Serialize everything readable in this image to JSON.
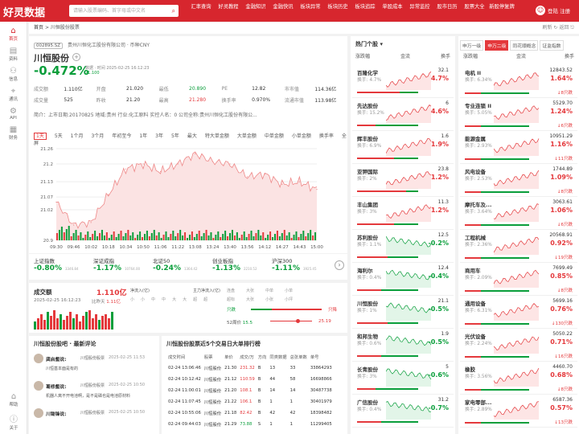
{
  "header": {
    "logo": "好灵数据",
    "search_placeholder": "请输入股票编码、首字母或中文名",
    "nav": [
      "汇率查询",
      "好灵教程",
      "金融知识",
      "金融快讯",
      "板块异常",
      "板块历史",
      "板块追踪",
      "单股成本",
      "异常监控",
      "股市日历",
      "股票大全",
      "新股停复牌"
    ],
    "user": "登陆 注册"
  },
  "sidebar": [
    {
      "glyph": "⌂",
      "label": "首页"
    },
    {
      "glyph": "▤",
      "label": "资料"
    },
    {
      "glyph": "⚇",
      "label": "信息"
    },
    {
      "glyph": "⌖",
      "label": "通讯"
    },
    {
      "glyph": "⚙",
      "label": "API"
    },
    {
      "glyph": "▦",
      "label": "财务"
    }
  ],
  "sidebar_bottom": [
    {
      "glyph": "⌂",
      "label": "帮助"
    },
    {
      "glyph": "ⓘ",
      "label": "关于"
    }
  ],
  "breadcrumb": {
    "home": "首页",
    "sep": ">",
    "current": "川恒股份股票",
    "refresh": "刷新",
    "back": "返回"
  },
  "stock": {
    "code": "002895.SZ",
    "company": "贵州川恒化工股份有限公司 · 币种CNY",
    "name": "川恒股份",
    "time_label": "数据 · 时间",
    "time": "2025-02-25 16:12:23",
    "pct": "-0.472%",
    "price": "21.100",
    "stats": [
      [
        "成交额",
        "1.110亿",
        "开盘",
        "21.020",
        "最低",
        "20.890",
        "PE",
        "12.82",
        "市市值",
        "114.36亿"
      ],
      [
        "成交量",
        "525",
        "昨收",
        "21.20",
        "最高",
        "21.280",
        "换手率",
        "0.970%",
        "流通市值",
        "113.98亿"
      ]
    ],
    "intro": "简介：上市日期:20170825 地域:贵州 行业:化工原料 实控人名：0 公司全称:贵州川恒化工股份有限公..."
  },
  "period_tabs": [
    "1天",
    "5天",
    "1个月",
    "3个月",
    "年初至今",
    "1年",
    "3年",
    "5年",
    "最大",
    "特大单金额",
    "大单金额",
    "中单金额",
    "小单金额",
    "换手率",
    "全屏"
  ],
  "chart_data": {
    "type": "area",
    "title": "",
    "xlabel": "",
    "ylabel": "",
    "x": [
      "09:30",
      "09:46",
      "10:02",
      "10:18",
      "10:34",
      "10:50",
      "11:06",
      "11:22",
      "13:08",
      "13:24",
      "13:40",
      "13:56",
      "14:12",
      "14:27",
      "14:43",
      "15:00"
    ],
    "values": [
      21.05,
      20.96,
      20.97,
      21.08,
      21.18,
      21.2,
      21.17,
      21.2,
      21.24,
      21.21,
      21.2,
      21.15,
      21.16,
      21.12,
      21.13,
      21.1
    ],
    "y_ticks": [
      "21.26",
      "21.2",
      "21.13",
      "21.07",
      "21.02",
      "20.9"
    ],
    "ylim": [
      20.9,
      21.26
    ],
    "grid": true
  },
  "indices": [
    {
      "name": "上证指数",
      "pct": "-0.80%",
      "val": "3346.84",
      "c": "green"
    },
    {
      "name": "深证成指",
      "pct": "-1.17%",
      "val": "10764.00",
      "c": "green"
    },
    {
      "name": "北证50",
      "pct": "-0.24%",
      "val": "1364.42",
      "c": "green"
    },
    {
      "name": "创业板指",
      "pct": "-1.13%",
      "val": "2210.52",
      "c": "green"
    },
    {
      "name": "沪深300",
      "pct": "-1.11%",
      "val": "3925.45",
      "c": "green"
    }
  ],
  "turnover": {
    "title": "成交额",
    "value": "1.110亿",
    "time": "2025-02-25 16:12:23",
    "prev_label": "比昨天",
    "prev": "1.11亿",
    "bars": [
      4,
      6,
      8,
      5,
      9,
      7,
      10,
      6,
      8,
      5,
      7,
      9,
      6,
      8,
      4,
      7,
      9,
      10,
      6,
      8,
      5,
      7,
      8,
      6,
      9
    ],
    "net_in": "净流入(亿)",
    "net_labels": [
      "小",
      "小",
      "中",
      "中",
      "大",
      "大",
      "超",
      "超"
    ],
    "main_net": "主力净流入(亿)",
    "size_labels": [
      "连盘",
      "大张",
      "中单",
      "小单"
    ],
    "size2": [
      "超标",
      "大张",
      "小张",
      "小坪"
    ],
    "range_label": "52周价",
    "low": "15.5",
    "high": "25.19",
    "only_buy": "只跌",
    "only_sell": "只降"
  },
  "comments": {
    "title": "川恒股份股吧 · 最新评论",
    "items": [
      {
        "user": "龚启壑说:",
        "src": "川恒股份股票",
        "time": "2025-02-25 11:53",
        "text": "川恒基本面是有的"
      },
      {
        "user": "葛修壑说:",
        "src": "川恒股份股票",
        "time": "2025-02-25 10:50",
        "text": "机器人离不开电池啊，是不是磷也是电池原材料"
      },
      {
        "user": "川锄锋说:",
        "src": "川恒股份股票",
        "time": "2025-02-25 10:50",
        "text": ""
      }
    ]
  },
  "orders": {
    "title": "川恒股份股票近5个交易日大单排行榜",
    "headers": [
      "成交时间",
      "股票",
      "单价",
      "成交/万",
      "方向",
      "同类数据",
      "总张单数",
      "单号"
    ],
    "rows": [
      [
        "02-24 13:06:46",
        "川恒股份",
        "21.30",
        "231.32",
        "B",
        "13",
        "33",
        "33864293"
      ],
      [
        "02-24 10:12:42",
        "川恒股份",
        "21.12",
        "110.59",
        "B",
        "44",
        "58",
        "16698866"
      ],
      [
        "02-24 11:00:01",
        "川恒股份",
        "21.20",
        "108.1",
        "B",
        "14",
        "14",
        "30487738"
      ],
      [
        "02-24 11:07:45",
        "川恒股份",
        "21.22",
        "106.1",
        "B",
        "1",
        "1",
        "30401979"
      ],
      [
        "02-24 10:55:06",
        "川恒股份",
        "21.18",
        "82.42",
        "B",
        "42",
        "42",
        "18398482"
      ],
      [
        "02-24 09:44:03",
        "川恒股份",
        "21.29",
        "73.88",
        "S",
        "1",
        "1",
        "11299405"
      ]
    ]
  },
  "hot": {
    "title": "热门个股",
    "col1": "涨跌幅",
    "col2": "金流",
    "col3": "换手",
    "items": [
      [
        "百隆化学",
        "换手: 4.7%",
        "32.1",
        "4.7%",
        "red",
        0.7
      ],
      [
        "先达股份",
        "换手: 15.2%",
        "6",
        "4.6%",
        "red",
        0.3
      ],
      [
        "辉丰股份",
        "换手: 6.9%",
        "1.6",
        "1.9%",
        "red",
        0.6
      ],
      [
        "亚钾国际",
        "换手: 2%",
        "23.8",
        "1.2%",
        "red",
        0.8
      ],
      [
        "丰山集团",
        "换手: 3%",
        "11.3",
        "1.2%",
        "red",
        0.6
      ],
      [
        "苏利股份",
        "换手: 1.1%",
        "12.5",
        "-0.2%",
        "green",
        0.5
      ],
      [
        "海利尔",
        "换手: 0.4%",
        "12.4",
        "-0.4%",
        "green",
        0.4
      ],
      [
        "川恒股份",
        "换手: 1%",
        "21.1",
        "-0.5%",
        "green",
        0.5
      ],
      [
        "和邦生物",
        "换手: 0.6%",
        "1.9",
        "-0.5%",
        "green",
        0.4
      ],
      [
        "长青股份",
        "换手: 3%",
        "5",
        "-0.6%",
        "green",
        0.3
      ],
      [
        "广信股份",
        "换手: 0.4%",
        "31.2",
        "-0.7%",
        "green",
        0.4
      ]
    ]
  },
  "sectors": {
    "tabs": [
      "申万一级",
      "申万二级",
      "同花顺概念",
      "证监指数"
    ],
    "col1": "涨跌幅",
    "col2": "金流",
    "col3": "换手",
    "items": [
      [
        "电机 II",
        "换手: 6.34%",
        "12843.52",
        "1.64%",
        "red",
        "8只跌",
        "↓"
      ],
      [
        "专业连锁 II",
        "换手: 5.05%",
        "5529.70",
        "1.24%",
        "red",
        "6只跌",
        "↓"
      ],
      [
        "能源金属",
        "换手: 2.93%",
        "10951.29",
        "1.16%",
        "red",
        "11只跌",
        "↓"
      ],
      [
        "风电设备",
        "换手: 2.53%",
        "1744.89",
        "1.09%",
        "red",
        "8只跌",
        "↓"
      ],
      [
        "摩托车及...",
        "换手: 3.64%",
        "3063.61",
        "1.06%",
        "red",
        "6只跌",
        "↓"
      ],
      [
        "工程机械",
        "换手: 2.36%",
        "20568.91",
        "0.92%",
        "red",
        "19只跌",
        "↓"
      ],
      [
        "商用车",
        "换手: 2.09%",
        "7699.49",
        "0.85%",
        "red",
        "8只跌",
        "↓"
      ],
      [
        "通用设备",
        "换手: 6.31%",
        "5699.16",
        "0.76%",
        "red",
        "130只跌",
        "↓"
      ],
      [
        "光伏设备",
        "换手: 2.24%",
        "5050.22",
        "0.71%",
        "red",
        "16只跌",
        "↓"
      ],
      [
        "橡胶",
        "换手: 3.56%",
        "4460.70",
        "0.68%",
        "red",
        "8只跌",
        "↓"
      ],
      [
        "家电零部...",
        "换手: 2.89%",
        "6587.36",
        "0.57%",
        "red",
        "13只跌",
        "↓"
      ]
    ]
  }
}
